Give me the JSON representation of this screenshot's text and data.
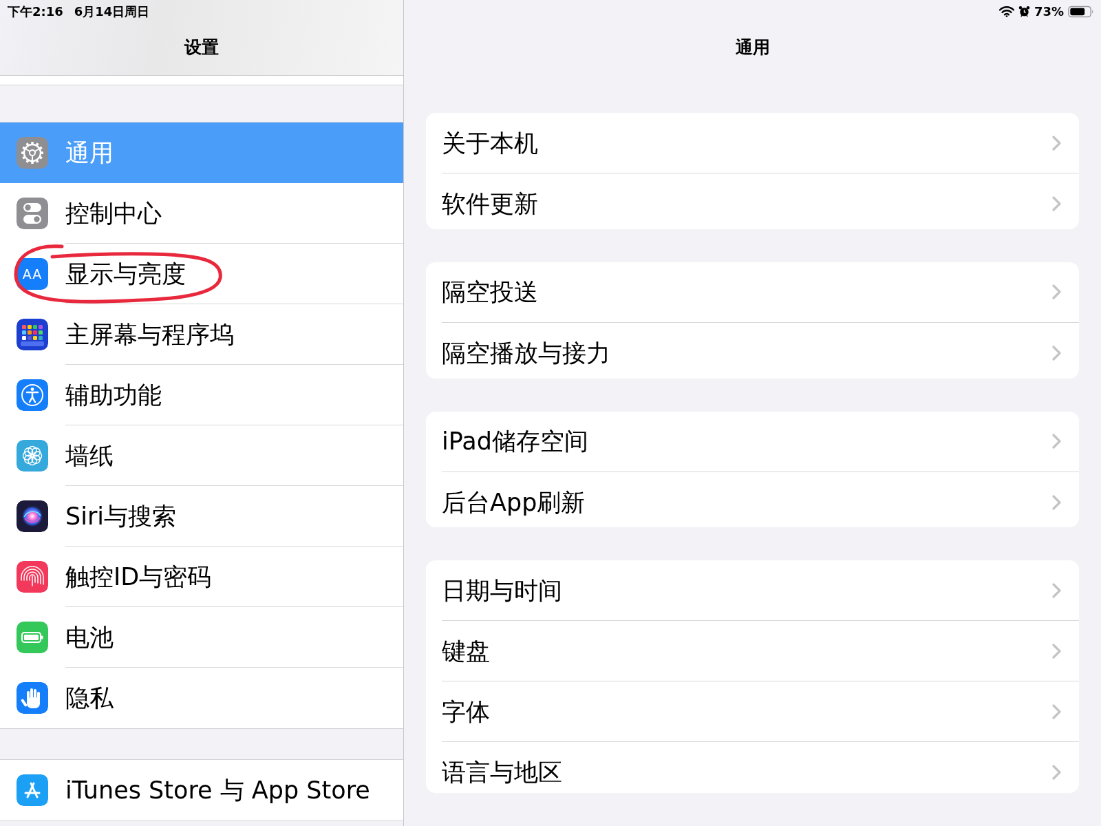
{
  "status_bar": {
    "time": "下午2:16",
    "date": "6月14日周日",
    "battery_percent": "73%"
  },
  "sidebar": {
    "title": "设置",
    "groups": [
      {
        "items": [
          {
            "label": "通用",
            "selected": true,
            "circled": false
          },
          {
            "label": "控制中心",
            "selected": false,
            "circled": false
          },
          {
            "label": "显示与亮度",
            "selected": false,
            "circled": true,
            "icon_text": "AA"
          },
          {
            "label": "主屏幕与程序坞",
            "selected": false,
            "circled": false
          },
          {
            "label": "辅助功能",
            "selected": false,
            "circled": false
          },
          {
            "label": "墙纸",
            "selected": false,
            "circled": false
          },
          {
            "label": "Siri与搜索",
            "selected": false,
            "circled": false
          },
          {
            "label": "触控ID与密码",
            "selected": false,
            "circled": false
          },
          {
            "label": "电池",
            "selected": false,
            "circled": false
          },
          {
            "label": "隐私",
            "selected": false,
            "circled": false
          }
        ]
      },
      {
        "items": [
          {
            "label": "iTunes Store 与 App Store",
            "selected": false,
            "circled": false
          }
        ]
      }
    ]
  },
  "detail": {
    "title": "通用",
    "groups": [
      {
        "rows": [
          {
            "label": "关于本机"
          },
          {
            "label": "软件更新"
          }
        ]
      },
      {
        "rows": [
          {
            "label": "隔空投送"
          },
          {
            "label": "隔空播放与接力"
          }
        ]
      },
      {
        "rows": [
          {
            "label": "iPad储存空间"
          },
          {
            "label": "后台App刷新"
          }
        ]
      },
      {
        "rows": [
          {
            "label": "日期与时间"
          },
          {
            "label": "键盘"
          },
          {
            "label": "字体"
          },
          {
            "label": "语言与地区"
          }
        ]
      }
    ]
  }
}
